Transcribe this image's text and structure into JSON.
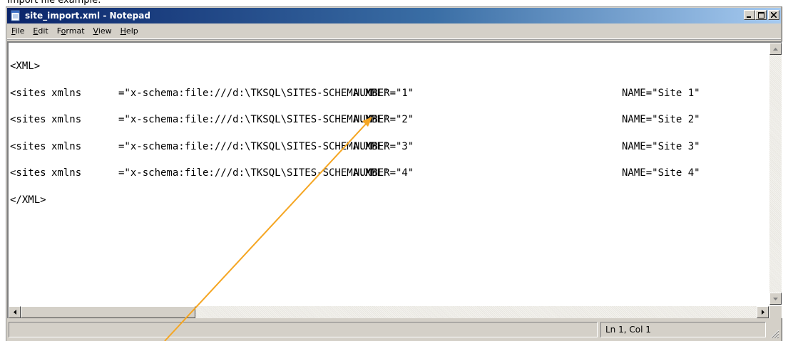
{
  "caption": "Import file example:",
  "window": {
    "title": "site_import.xml - Notepad",
    "icon": "notepad-icon",
    "buttons": [
      "minimize",
      "maximize",
      "close"
    ]
  },
  "menu": {
    "items": [
      {
        "label": "File",
        "underline": "F"
      },
      {
        "label": "Edit",
        "underline": "E"
      },
      {
        "label": "Format",
        "underline": "o"
      },
      {
        "label": "View",
        "underline": "V"
      },
      {
        "label": "Help",
        "underline": "H"
      }
    ]
  },
  "document": {
    "lines": [
      {
        "c1": "<XML>",
        "c2": "",
        "c3": "",
        "c4": "",
        "c5": ""
      },
      {
        "c1": "<sites",
        "c2": "xmlns",
        "c3": "=\"x-schema:file:///d:\\TKSQL\\SITES-SCHEMA.XML\"",
        "c4": "NUMBER=\"1\"",
        "c5": "NAME=\"Site 1\""
      },
      {
        "c1": "<sites",
        "c2": "xmlns",
        "c3": "=\"x-schema:file:///d:\\TKSQL\\SITES-SCHEMA.XML\"",
        "c4": "NUMBER=\"2\"",
        "c5": "NAME=\"Site 2\""
      },
      {
        "c1": "<sites",
        "c2": "xmlns",
        "c3": "=\"x-schema:file:///d:\\TKSQL\\SITES-SCHEMA.XML\"",
        "c4": "NUMBER=\"3\"",
        "c5": "NAME=\"Site 3\""
      },
      {
        "c1": "<sites",
        "c2": "xmlns",
        "c3": "=\"x-schema:file:///d:\\TKSQL\\SITES-SCHEMA.XML\"",
        "c4": "NUMBER=\"4\"",
        "c5": "NAME=\"Site 4\""
      },
      {
        "c1": "</XML>",
        "c2": "",
        "c3": "",
        "c4": "",
        "c5": ""
      }
    ]
  },
  "status": {
    "position": "Ln 1, Col 1"
  },
  "colors": {
    "titlebar_start": "#0a246a",
    "titlebar_end": "#a6caf0",
    "chrome": "#d4d0c8",
    "annotation_arrow": "#f5a623"
  }
}
